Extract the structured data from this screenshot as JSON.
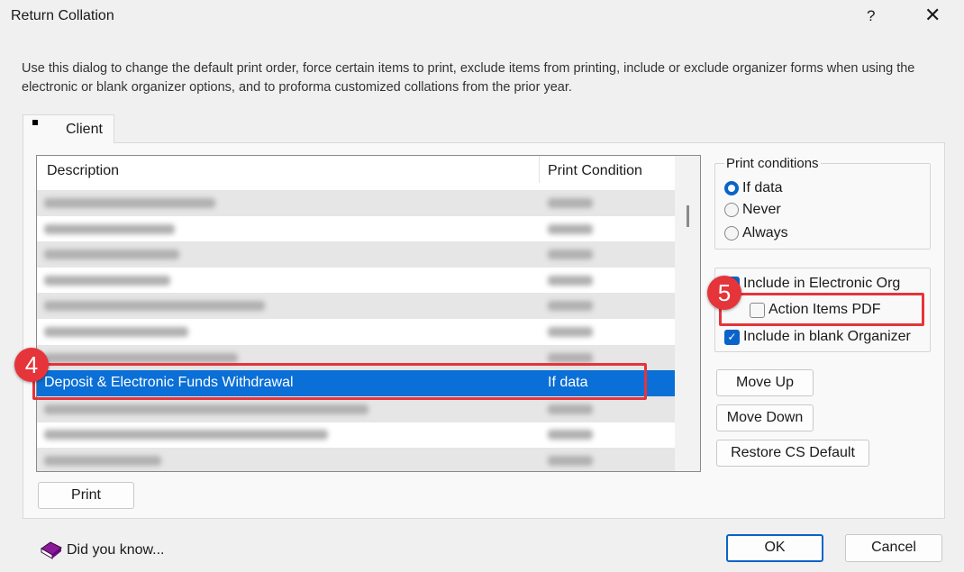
{
  "window": {
    "title": "Return Collation",
    "help_label": "?",
    "close_label": "✕"
  },
  "description": "Use this dialog to change the default print order, force certain items to print, exclude items from printing, include or exclude organizer forms when using the electronic or blank organizer options, and to proforma customized collations from the prior year.",
  "tabs": [
    {
      "label": "Client"
    }
  ],
  "list": {
    "columns": [
      "Description",
      "Print Condition"
    ],
    "selected_row": {
      "description": "Deposit & Electronic Funds Withdrawal",
      "condition": "If data"
    }
  },
  "print_conditions": {
    "label": "Print conditions",
    "options": [
      "If data",
      "Never",
      "Always"
    ],
    "selected": "If data"
  },
  "organizer": {
    "include_electronic": {
      "label": "Include in Electronic Org",
      "checked": true
    },
    "action_items_pdf": {
      "label": "Action Items PDF",
      "checked": false
    },
    "include_blank": {
      "label": "Include in blank Organizer",
      "checked": true
    }
  },
  "buttons": {
    "move_up": "Move Up",
    "move_down": "Move Down",
    "restore": "Restore CS Default",
    "print": "Print",
    "ok": "OK",
    "cancel": "Cancel"
  },
  "did_you_know": "Did you know...",
  "annotations": [
    "4",
    "5"
  ],
  "colors": {
    "selection": "#0a6fd6",
    "annotation": "#e5343a",
    "accent": "#0a63c9"
  }
}
